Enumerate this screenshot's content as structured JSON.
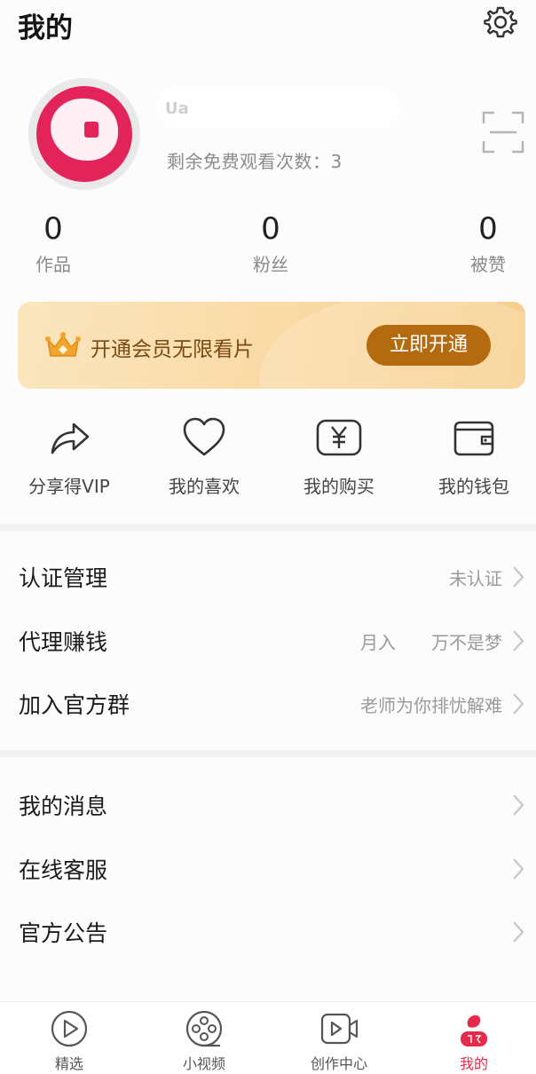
{
  "header": {
    "title": "我的"
  },
  "profile": {
    "free_count_label": "剩余免费观看次数：3",
    "nickname_visible": "Ua"
  },
  "stats": [
    {
      "value": "0",
      "label": "作品"
    },
    {
      "value": "0",
      "label": "粉丝"
    },
    {
      "value": "0",
      "label": "被赞"
    }
  ],
  "vip": {
    "text": "开通会员无限看片",
    "button": "立即开通"
  },
  "quick_actions": [
    {
      "label": "分享得VIP",
      "icon": "share-icon"
    },
    {
      "label": "我的喜欢",
      "icon": "heart-icon"
    },
    {
      "label": "我的购买",
      "icon": "yen-icon"
    },
    {
      "label": "我的钱包",
      "icon": "wallet-icon"
    }
  ],
  "menu_group_1": [
    {
      "label": "认证管理",
      "value": "未认证"
    },
    {
      "label": "代理赚钱",
      "value": "月入　　万不是梦"
    },
    {
      "label": "加入官方群",
      "value": "老师为你排忧解难"
    }
  ],
  "menu_group_2": [
    {
      "label": "我的消息",
      "value": ""
    },
    {
      "label": "在线客服",
      "value": ""
    },
    {
      "label": "官方公告",
      "value": ""
    }
  ],
  "tabbar": [
    {
      "label": "精选",
      "icon": "play-circle-icon"
    },
    {
      "label": "小视频",
      "icon": "film-reel-icon"
    },
    {
      "label": "创作中心",
      "icon": "video-camera-icon"
    },
    {
      "label": "我的",
      "icon": "profile-icon",
      "active": true
    }
  ],
  "colors": {
    "accent": "#e62a4c",
    "vip_button": "#b46b10",
    "vip_text": "#7a4a12"
  }
}
